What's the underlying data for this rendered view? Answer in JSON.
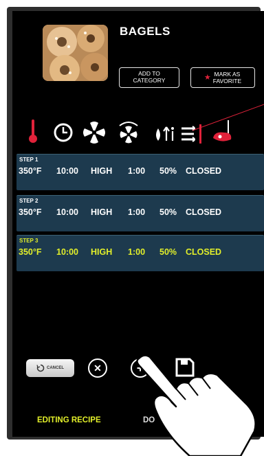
{
  "recipe": {
    "title": "BAGELS",
    "photo_alt": "bagels-photo"
  },
  "buttons": {
    "add_to_category": [
      "ADD TO",
      "CATEGORY"
    ],
    "mark_as_favorite": [
      "MARK AS",
      "FAVORITE"
    ],
    "cancel": "CANCEL"
  },
  "param_icons": [
    "thermometer-icon",
    "clock-icon",
    "fan-icon",
    "fan-speed-icon",
    "humidity-icon",
    "vent-icon",
    "probe-icon"
  ],
  "steps": [
    {
      "label": "STEP 1",
      "temp": "350°F",
      "time": "10:00",
      "fan": "HIGH",
      "fan_time": "1:00",
      "humidity": "50%",
      "vent": "CLOSED",
      "active": false
    },
    {
      "label": "STEP 2",
      "temp": "350°F",
      "time": "10:00",
      "fan": "HIGH",
      "fan_time": "1:00",
      "humidity": "50%",
      "vent": "CLOSED",
      "active": false
    },
    {
      "label": "STEP 3",
      "temp": "350°F",
      "time": "10:00",
      "fan": "HIGH",
      "fan_time": "1:00",
      "humidity": "50%",
      "vent": "CLOSED",
      "active": true
    }
  ],
  "footer": {
    "left": "EDITING RECIPE",
    "right": "DO"
  },
  "colors": {
    "accent": "#e2ef2a",
    "row": "#1d3a4e",
    "icon_red": "#e0223a",
    "screen": "#000000"
  }
}
